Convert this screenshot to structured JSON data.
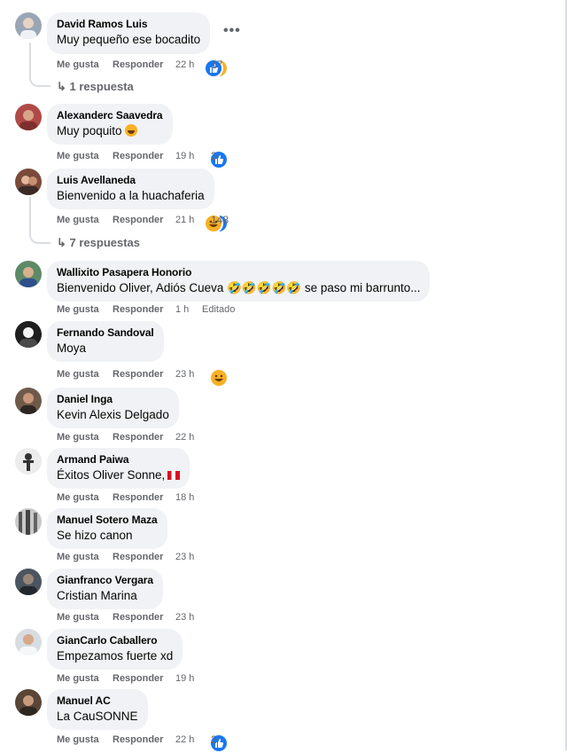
{
  "comments": [
    {
      "author": "David Ramos Luis",
      "text": "Muy pequeño ese bocadito",
      "like": "Me gusta",
      "reply": "Responder",
      "time": "22 h",
      "reactions": [
        "haha",
        "like"
      ],
      "reaction_count": "17",
      "replies": "1 respuesta",
      "more_options": "•••",
      "avatar_color": "#9aa6b5"
    },
    {
      "author": "Alexanderc Saavedra",
      "text": "Muy poquito",
      "like": "Me gusta",
      "reply": "Responder",
      "time": "19 h",
      "reactions": [
        "like"
      ],
      "reaction_count": "3",
      "trailing_emoji": "smile",
      "avatar_color": "#b04a48"
    },
    {
      "author": "Luis Avellaneda",
      "text": "Bienvenido a la huachaferia",
      "like": "Me gusta",
      "reply": "Responder",
      "time": "21 h",
      "reactions": [
        "like",
        "haha"
      ],
      "reaction_count": "148",
      "replies": "7 respuestas",
      "avatar_color": "#7a4a3a"
    },
    {
      "author": "Wallixito Pasapera Honorio",
      "text": "Bienvenido Oliver, Adiós Cueva 🤣🤣🤣🤣🤣 se paso mi barrunto...",
      "like": "Me gusta",
      "reply": "Responder",
      "time": "1 h",
      "edited": "Editado",
      "avatar_color": "#5d8a66"
    },
    {
      "author": "Fernando Sandoval",
      "text": "Moya",
      "like": "Me gusta",
      "reply": "Responder",
      "time": "23 h",
      "reactions": [
        "haha"
      ],
      "reaction_count": "",
      "avatar_color": "#2b2b2b"
    },
    {
      "author": "Daniel Inga",
      "text": "Kevin Alexis Delgado",
      "like": "Me gusta",
      "reply": "Responder",
      "time": "22 h",
      "avatar_color": "#6f5a4a"
    },
    {
      "author": "Armand Paiwa",
      "text": "Éxitos Oliver Sonne,",
      "like": "Me gusta",
      "reply": "Responder",
      "time": "18 h",
      "trailing_emoji": "peru-flag",
      "avatar_color": "#e8e8e8"
    },
    {
      "author": "Manuel Sotero Maza",
      "text": "Se hizo canon",
      "like": "Me gusta",
      "reply": "Responder",
      "time": "23 h",
      "avatar_color": "#c9c9c9"
    },
    {
      "author": "Gianfranco Vergara",
      "text": "Cristian Marina",
      "like": "Me gusta",
      "reply": "Responder",
      "time": "23 h",
      "avatar_color": "#4b5560"
    },
    {
      "author": "GianCarlo Caballero",
      "text": "Empezamos fuerte xd",
      "like": "Me gusta",
      "reply": "Responder",
      "time": "19 h",
      "avatar_color": "#d8dde2"
    },
    {
      "author": "Manuel AC",
      "text": "La CauSONNE",
      "like": "Me gusta",
      "reply": "Responder",
      "time": "22 h",
      "reactions": [
        "like"
      ],
      "reaction_count": "2",
      "avatar_color": "#5a4638"
    }
  ],
  "colors": {
    "like_blue": "#1877f2",
    "haha_yellow": "#f7b125",
    "meta_gray": "#65676b",
    "bubble": "#f0f2f5"
  }
}
